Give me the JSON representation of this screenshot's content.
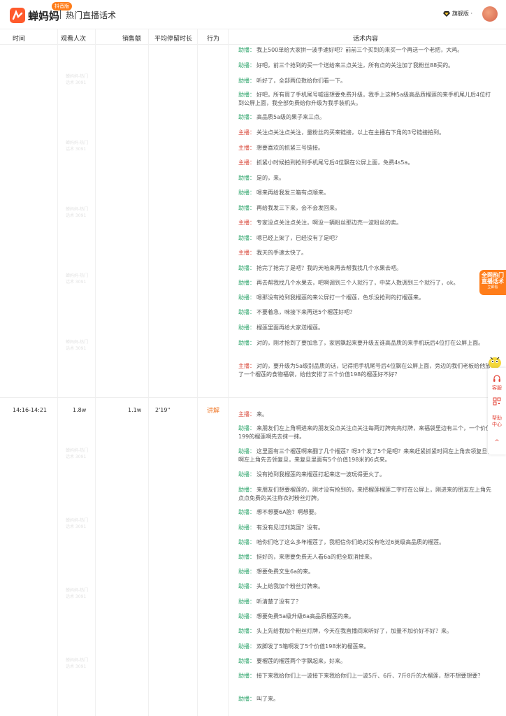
{
  "header": {
    "logo_text": "蝉妈妈",
    "badge": "抖音版",
    "page_title": "热门直播话术",
    "user_label": "旗舰版 ·"
  },
  "table": {
    "headers": [
      "时间",
      "观看人次",
      "销售额",
      "平均停留时长",
      "行为",
      "话术内容"
    ]
  },
  "row2": {
    "time": "14:16-14:21",
    "viewers": "1.8w",
    "sales": "1.1w",
    "avg_stay": "2'19''",
    "action": "讲解"
  },
  "watermark": "蝉妈妈-热门话术 3091",
  "speakers": {
    "assist": "助播：",
    "host": "主播："
  },
  "script_lines": [
    {
      "sp": "assist",
      "text": "我上500单给大家拼一波手速好吧？前前三个买到的来买一个再送一个老把，大鸡。"
    },
    {
      "sp": "assist",
      "text": "好吧，前三个抢到的买一个送给来三点关注，所有点的关注加了我粉丝88买的。"
    },
    {
      "sp": "assist",
      "text": "听好了，全部两位数给你们看一下。"
    },
    {
      "sp": "assist",
      "text": "好吧，所有買了手机尾号嘘遥想要免费升级，我手上这种5a级高品质榴莲的来手机尾儿后4位打到公屏上面，我全部免费给你升级为我手装机头。"
    },
    {
      "sp": "assist",
      "text": "高品质5a级的果子来三点。"
    },
    {
      "sp": "host",
      "text": "关注点关注点关注，量粉丝的买来链接，以上在主播右下角的3号链接拍到。"
    },
    {
      "sp": "host",
      "text": "想要喜欢的抓紧三号链接。"
    },
    {
      "sp": "host",
      "text": "抓紧小时候拍到抢到手机尾号后4位飘在公屏上面，免费4s5a。"
    },
    {
      "sp": "assist",
      "text": "是的，来。"
    },
    {
      "sp": "assist",
      "text": "嗯来再给我发三箱有点顺来。"
    },
    {
      "sp": "assist",
      "text": "再给我发三下来，会不会发回来。"
    },
    {
      "sp": "host",
      "text": "专家没点关注点关注，啊没一辆粉丝那边売一波粉丝的卖。"
    },
    {
      "sp": "assist",
      "text": "嗯已经上架了，已经没有了是吧？"
    },
    {
      "sp": "host",
      "text": "我天的手速太快了。"
    },
    {
      "sp": "assist",
      "text": "抢完了抢完了是吧？我的天咱来再去帮我找几个水果去吧。"
    },
    {
      "sp": "assist",
      "text": "再去帮我找几个水果去，吧啊调到三个人就行了，中奖人数调到三个就行了，ok。"
    },
    {
      "sp": "assist",
      "text": "嗯那没有抢到我榴莲的来公屏打一个榴莲，色乐没抢到的打榴莲来。"
    },
    {
      "sp": "assist",
      "text": "不要着急，咪接下来再送5个榴莲好吧？"
    },
    {
      "sp": "assist",
      "text": "榴莲里面再给大家送榴莲。"
    },
    {
      "sp": "assist",
      "text": "对的，刚才抢到了要加急了，家居飘起来要升级五谁高品质的来手机玩后4位打在公屏上面。"
    },
    {
      "sp": "host",
      "text": "对的，要升级为5a级别品质的话，记得把手机尾号后4位飘在公屏上面，旁边的我们老板给他放了一个榴莲的食物福袋，给他安排了三个价值198的榴莲好不好？"
    },
    {
      "sp": "host",
      "text": "来。"
    },
    {
      "sp": "assist",
      "text": "来朋友们左上角啊进来的朋友没点关注点关注每两灯牌亮亮灯牌，来福袋里边有三个，一个价值199的榴莲啊先去抹一抹。"
    },
    {
      "sp": "assist",
      "text": "这里面有三个榴莲啊来翻了几个榴莲？呀3个发了5个是吧？来来赶紧抓紧时间左上角去领复旦，啊左上角先去领复旦，来复旦里面有5个价值198米的6点来。"
    },
    {
      "sp": "assist",
      "text": "没有抢到我榴莲的来榴莲打起来这一波玩得更火了。"
    },
    {
      "sp": "assist",
      "text": "来朋友们想要榴莲的，刚才没有抢到的，来把榴莲榴莲二字打在公屏上，刚进来的朋友左上角先点点免费的关注称衣衬粉丝灯牌。"
    },
    {
      "sp": "assist",
      "text": "想不想要6A脸？啊想要。"
    },
    {
      "sp": "assist",
      "text": "有没有见过刘英国？没有。"
    },
    {
      "sp": "assist",
      "text": "咱你们吃了这么多年榴莲了，我相信你们绝对没有吃过6英级高品质的榴莲。"
    },
    {
      "sp": "assist",
      "text": "挺好的，来想要免费无人看6a的把全取消掉来。"
    },
    {
      "sp": "assist",
      "text": "想要免费文生6a的来。"
    },
    {
      "sp": "assist",
      "text": "头上给我加个粉丝灯牌来。"
    },
    {
      "sp": "assist",
      "text": "听清楚了没有了？"
    },
    {
      "sp": "assist",
      "text": "想要免费5a级升级6a高品质榴莲的来。"
    },
    {
      "sp": "assist",
      "text": "头上先给我加个粉丝灯牌，今天在我直播间来听好了，加量不加价好不好？来。"
    },
    {
      "sp": "assist",
      "text": "双脚发了5箱啊发了5个价值198米的榴莲来。"
    },
    {
      "sp": "assist",
      "text": "要榴莲的榴莲两个字飘起来，好来。"
    },
    {
      "sp": "assist",
      "text": "接下来我给你们上一波接下来我给你们上一波5斤、6斤、7斤8斤的大榴莲，想不想要想要？"
    },
    {
      "sp": "assist",
      "text": "叫了来。"
    }
  ],
  "float": {
    "promo": "全网热门直播话术",
    "promo_sub": "立即看",
    "service": "客服",
    "help": "帮助中心",
    "top": "^"
  }
}
